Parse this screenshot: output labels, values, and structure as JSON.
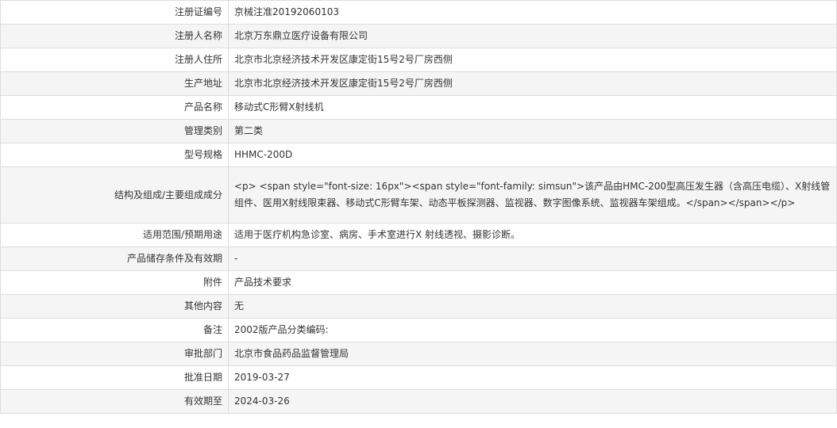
{
  "rows": [
    {
      "label": "注册证编号",
      "value": "京械注准20192060103"
    },
    {
      "label": "注册人名称",
      "value": "北京万东鼎立医疗设备有限公司"
    },
    {
      "label": "注册人住所",
      "value": "北京市北京经济技术开发区康定街15号2号厂房西侧"
    },
    {
      "label": "生产地址",
      "value": "北京市北京经济技术开发区康定街15号2号厂房西侧"
    },
    {
      "label": "产品名称",
      "value": "移动式C形臂X射线机"
    },
    {
      "label": "管理类别",
      "value": "第二类"
    },
    {
      "label": "型号规格",
      "value": "HHMC-200D"
    },
    {
      "label": "结构及组成/主要组成成分",
      "value": "<p> <span style=\"font-size: 16px\"><span style=\"font-family: simsun\">该产品由HMC-200型高压发生器（含高压电缆）、X射线管组件、医用X射线限束器、移动式C形臂车架、动态平板探测器、监视器、数字图像系统、监视器车架组成。</span></span></p>"
    },
    {
      "label": "适用范围/预期用途",
      "value": "适用于医疗机构急诊室、病房、手术室进行X 射线透视、摄影诊断。"
    },
    {
      "label": "产品储存条件及有效期",
      "value": "-"
    },
    {
      "label": "附件",
      "value": "产品技术要求"
    },
    {
      "label": "其他内容",
      "value": "无"
    },
    {
      "label": "备注",
      "value": "2002版产品分类编码:"
    },
    {
      "label": "审批部门",
      "value": "北京市食品药品监督管理局"
    },
    {
      "label": "批准日期",
      "value": "2019-03-27"
    },
    {
      "label": "有效期至",
      "value": "2024-03-26"
    }
  ]
}
